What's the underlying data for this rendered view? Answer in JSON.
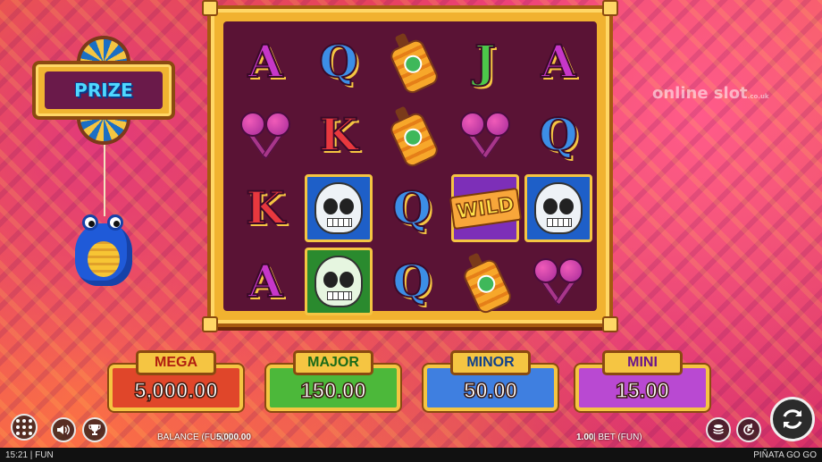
{
  "prize": {
    "label": "PRIZE"
  },
  "watermark": {
    "text": "online slot",
    "suffix": ".co.uk"
  },
  "reels": [
    [
      "A",
      "Q",
      "bottle",
      "J",
      "A"
    ],
    [
      "maracas",
      "K",
      "bottle",
      "maracas",
      "Q"
    ],
    [
      "K",
      "skull-blue",
      "Q",
      "WILD",
      "skull-blue"
    ],
    [
      "A",
      "skull-green",
      "Q",
      "bottle",
      "maracas"
    ]
  ],
  "wild_label": "WILD",
  "jackpots": {
    "mega": {
      "label": "MEGA",
      "amount": "5,000.00"
    },
    "major": {
      "label": "MAJOR",
      "amount": "150.00"
    },
    "minor": {
      "label": "MINOR",
      "amount": "50.00"
    },
    "mini": {
      "label": "MINI",
      "amount": "15.00"
    }
  },
  "footer": {
    "balance_label": "BALANCE (FUN) |",
    "balance_value": "5,000.00",
    "bet_value": "1.00",
    "bet_label": "| BET (FUN)"
  },
  "statusbar": {
    "left": "15:21 | FUN",
    "right": "PIÑATA GO GO"
  },
  "icons": {
    "menu": "grid-icon",
    "sound": "speaker-icon",
    "trophy": "trophy-icon",
    "stake": "coin-stack-icon",
    "autoplay": "autoplay-icon",
    "spin": "spin-icon"
  }
}
